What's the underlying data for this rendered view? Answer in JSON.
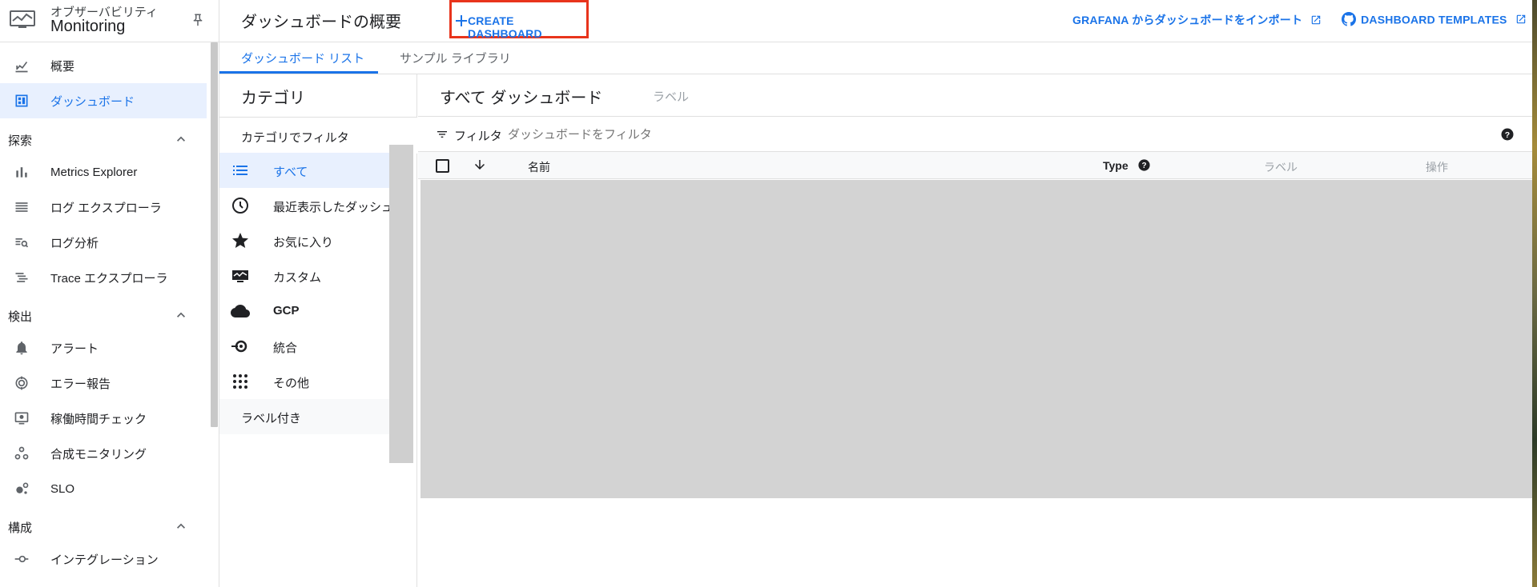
{
  "app": {
    "subtitle": "オブザーバビリティ",
    "title": "Monitoring"
  },
  "sidebar": {
    "top_items": [
      {
        "label": "概要",
        "icon": "overview-chart-icon"
      },
      {
        "label": "ダッシュボード",
        "icon": "dashboard-icon",
        "active": true
      }
    ],
    "sections": [
      {
        "title": "探索",
        "items": [
          {
            "label": "Metrics Explorer",
            "icon": "bar-chart-icon"
          },
          {
            "label": "ログ エクスプローラ",
            "icon": "logs-list-icon"
          },
          {
            "label": "ログ分析",
            "icon": "log-analytics-icon"
          },
          {
            "label": "Trace エクスプローラ",
            "icon": "trace-icon"
          }
        ]
      },
      {
        "title": "検出",
        "items": [
          {
            "label": "アラート",
            "icon": "bell-icon"
          },
          {
            "label": "エラー報告",
            "icon": "error-report-icon"
          },
          {
            "label": "稼働時間チェック",
            "icon": "monitor-icon"
          },
          {
            "label": "合成モニタリング",
            "icon": "synthetic-icon"
          },
          {
            "label": "SLO",
            "icon": "slo-icon"
          }
        ]
      },
      {
        "title": "構成",
        "items": [
          {
            "label": "インテグレーション",
            "icon": "integration-icon"
          }
        ]
      }
    ]
  },
  "header": {
    "page_title": "ダッシュボードの概要",
    "create_label": "CREATE DASHBOARD",
    "grafana_label": "GRAFANA からダッシュボードをインポート",
    "templates_label": "DASHBOARD TEMPLATES"
  },
  "tabs": [
    {
      "label": "ダッシュボード リスト",
      "active": true
    },
    {
      "label": "サンプル ライブラリ",
      "active": false
    }
  ],
  "categories": {
    "title": "カテゴリ",
    "filter_label": "カテゴリでフィルタ",
    "items": [
      {
        "label": "すべて",
        "icon": "list-icon",
        "active": true
      },
      {
        "label": "最近表示したダッシュボード",
        "icon": "clock-icon"
      },
      {
        "label": "お気に入り",
        "icon": "star-icon"
      },
      {
        "label": "カスタム",
        "icon": "custom-monitor-icon"
      },
      {
        "label": "GCP",
        "icon": "cloud-icon",
        "bold": true
      },
      {
        "label": "統合",
        "icon": "integration-icon"
      },
      {
        "label": "その他",
        "icon": "apps-grid-icon"
      }
    ],
    "labeled": "ラベル付き"
  },
  "main": {
    "title": "すべて ダッシュボード",
    "label_tab": "ラベル",
    "filter_label": "フィルタ",
    "filter_placeholder": "ダッシュボードをフィルタ",
    "columns": {
      "name": "名前",
      "type": "Type",
      "labels": "ラベル",
      "actions": "操作"
    }
  },
  "colors": {
    "accent": "#1a73e8",
    "highlight_border": "#e8341c",
    "active_bg": "#e8f0fe",
    "overlay": "#d3d3d3"
  }
}
